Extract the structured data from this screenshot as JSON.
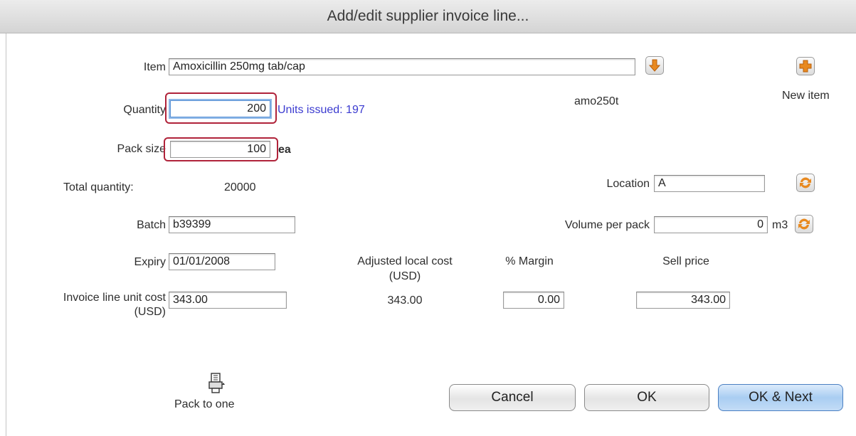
{
  "window": {
    "title": "Add/edit supplier invoice line..."
  },
  "item": {
    "label": "Item",
    "value": "Amoxicillin 250mg tab/cap",
    "code": "amo250t",
    "new_item_label": "New item"
  },
  "quantity": {
    "label": "Quantity",
    "value": "200",
    "units_issued": "Units issued: 197"
  },
  "pack_size": {
    "label": "Pack size",
    "value": "100",
    "unit": "ea"
  },
  "total_quantity": {
    "label": "Total quantity:",
    "value": "20000"
  },
  "location": {
    "label": "Location",
    "value": "A"
  },
  "batch": {
    "label": "Batch",
    "value": "b39399"
  },
  "volume": {
    "label": "Volume per pack",
    "value": "0",
    "unit": "m3"
  },
  "expiry": {
    "label": "Expiry",
    "value": "01/01/2008"
  },
  "columns": {
    "adjusted_cost": "Adjusted local cost",
    "adjusted_cost_unit": "(USD)",
    "margin": "% Margin",
    "sell_price": "Sell price"
  },
  "unit_cost": {
    "label": "Invoice line unit cost",
    "label_unit": "(USD)",
    "value": "343.00"
  },
  "adjusted_cost_value": "343.00",
  "margin_value": "0.00",
  "sell_price_value": "343.00",
  "pack_to_one": {
    "label": "Pack to one"
  },
  "buttons": {
    "cancel": "Cancel",
    "ok": "OK",
    "ok_next": "OK & Next"
  },
  "colors": {
    "highlight": "#b0233a",
    "link_text": "#3b3bd0",
    "icon_orange": "#e8891f"
  }
}
